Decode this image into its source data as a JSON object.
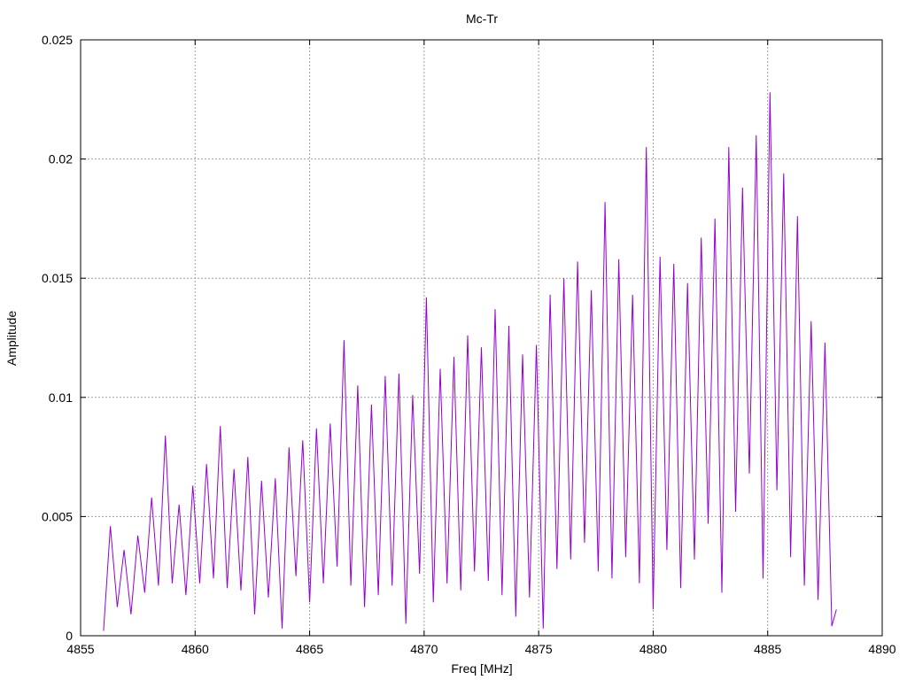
{
  "chart_data": {
    "type": "line",
    "title": "Mc-Tr",
    "xlabel": "Freq [MHz]",
    "ylabel": "Amplitude",
    "xlim": [
      4855,
      4890
    ],
    "ylim": [
      0,
      0.025
    ],
    "xticks": [
      4855,
      4860,
      4865,
      4870,
      4875,
      4880,
      4885,
      4890
    ],
    "xtick_labels": [
      "4855",
      "4860",
      "4865",
      "4870",
      "4875",
      "4880",
      "4885",
      "4890"
    ],
    "yticks": [
      0,
      0.005,
      0.01,
      0.015,
      0.02,
      0.025
    ],
    "ytick_labels": [
      "0",
      "0.005",
      "0.01",
      "0.015",
      "0.02",
      "0.025"
    ],
    "grid": true,
    "line_color": "#9400d3",
    "series": [
      {
        "x": [
          4856.0,
          4856.3,
          4856.6,
          4856.9,
          4857.2,
          4857.5,
          4857.8,
          4858.1,
          4858.4,
          4858.7,
          4859.0,
          4859.3,
          4859.6,
          4859.9,
          4860.2,
          4860.5,
          4860.8,
          4861.1,
          4861.4,
          4861.7,
          4862.0,
          4862.3,
          4862.6,
          4862.9,
          4863.2,
          4863.5,
          4863.8,
          4864.1,
          4864.4,
          4864.7,
          4865.0,
          4865.3,
          4865.6,
          4865.9,
          4866.2,
          4866.5,
          4866.8,
          4867.1,
          4867.4,
          4867.7,
          4868.0,
          4868.3,
          4868.6,
          4868.9,
          4869.2,
          4869.5,
          4869.8,
          4870.1,
          4870.4,
          4870.7,
          4871.0,
          4871.3,
          4871.6,
          4871.9,
          4872.2,
          4872.5,
          4872.8,
          4873.1,
          4873.4,
          4873.7,
          4874.0,
          4874.3,
          4874.6,
          4874.9,
          4875.2,
          4875.5,
          4875.8,
          4876.1,
          4876.4,
          4876.7,
          4877.0,
          4877.3,
          4877.6,
          4877.9,
          4878.2,
          4878.5,
          4878.8,
          4879.1,
          4879.4,
          4879.7,
          4880.0,
          4880.3,
          4880.6,
          4880.9,
          4881.2,
          4881.5,
          4881.8,
          4882.1,
          4882.4,
          4882.7,
          4883.0,
          4883.3,
          4883.6,
          4883.9,
          4884.2,
          4884.5,
          4884.8,
          4885.1,
          4885.4,
          4885.7,
          4886.0,
          4886.3,
          4886.6,
          4886.9,
          4887.2,
          4887.5,
          4887.8,
          4888.0
        ],
        "values": [
          0.0002,
          0.0046,
          0.0012,
          0.0036,
          0.0009,
          0.0042,
          0.0018,
          0.0058,
          0.0021,
          0.0084,
          0.0022,
          0.0055,
          0.0017,
          0.0063,
          0.0022,
          0.0072,
          0.0024,
          0.0088,
          0.002,
          0.007,
          0.0019,
          0.0075,
          0.0009,
          0.0065,
          0.0016,
          0.0066,
          0.0003,
          0.0079,
          0.0025,
          0.0082,
          0.0014,
          0.0087,
          0.0022,
          0.0089,
          0.0029,
          0.0124,
          0.0021,
          0.0105,
          0.0012,
          0.0097,
          0.0017,
          0.0109,
          0.0021,
          0.011,
          0.0005,
          0.0101,
          0.0026,
          0.0142,
          0.0014,
          0.0112,
          0.0022,
          0.0117,
          0.0019,
          0.0126,
          0.0027,
          0.0121,
          0.0023,
          0.0137,
          0.0017,
          0.013,
          0.0008,
          0.0118,
          0.0016,
          0.0122,
          0.0003,
          0.0143,
          0.0028,
          0.015,
          0.0032,
          0.0157,
          0.0039,
          0.0145,
          0.0027,
          0.0182,
          0.0024,
          0.0158,
          0.0033,
          0.0143,
          0.0022,
          0.0205,
          0.0011,
          0.0159,
          0.0036,
          0.0156,
          0.002,
          0.0148,
          0.0032,
          0.0167,
          0.0047,
          0.0175,
          0.0018,
          0.0205,
          0.0052,
          0.0188,
          0.0068,
          0.021,
          0.0024,
          0.0228,
          0.0061,
          0.0194,
          0.0033,
          0.0176,
          0.0021,
          0.0132,
          0.0015,
          0.0123,
          0.0004,
          0.0011
        ]
      }
    ]
  }
}
